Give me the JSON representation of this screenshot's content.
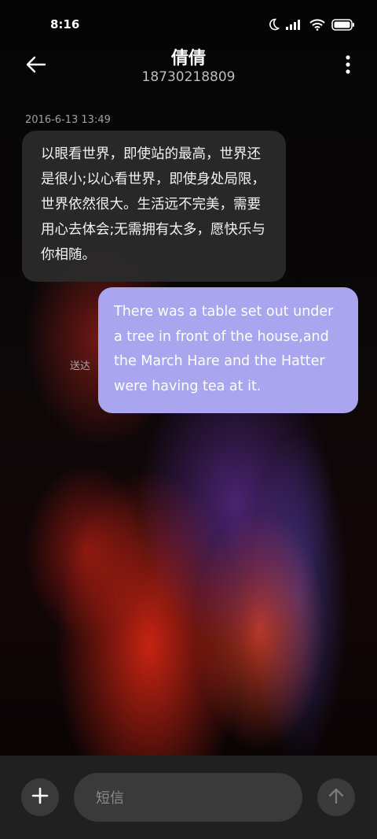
{
  "status_bar": {
    "time": "8:16",
    "icons": [
      "moon-icon",
      "signal-icon",
      "wifi-icon",
      "battery-icon"
    ]
  },
  "header": {
    "contact_name": "倩倩",
    "contact_number": "18730218809",
    "back_icon": "back-arrow-icon",
    "more_icon": "more-vertical-icon"
  },
  "conversation": {
    "timestamp": "2016-6-13 13:49",
    "incoming_message": "以眼看世界，即使站的最高，世界还是很小;以心看世界，即使身处局限，世界依然很大。生活远不完美，需要用心去体会;无需拥有太多，愿快乐与你相随。",
    "outgoing_message": "There was a table set out under a tree in front of the house,and the March Hare and the Hatter were having tea at it.",
    "outgoing_status": "送达"
  },
  "composer": {
    "placeholder": "短信",
    "add_icon": "plus-icon",
    "send_icon": "send-arrow-up-icon"
  },
  "colors": {
    "outgoing_bubble": "#a9a6ef",
    "incoming_bubble": "#2a2a2a",
    "composer_background": "#202020"
  }
}
